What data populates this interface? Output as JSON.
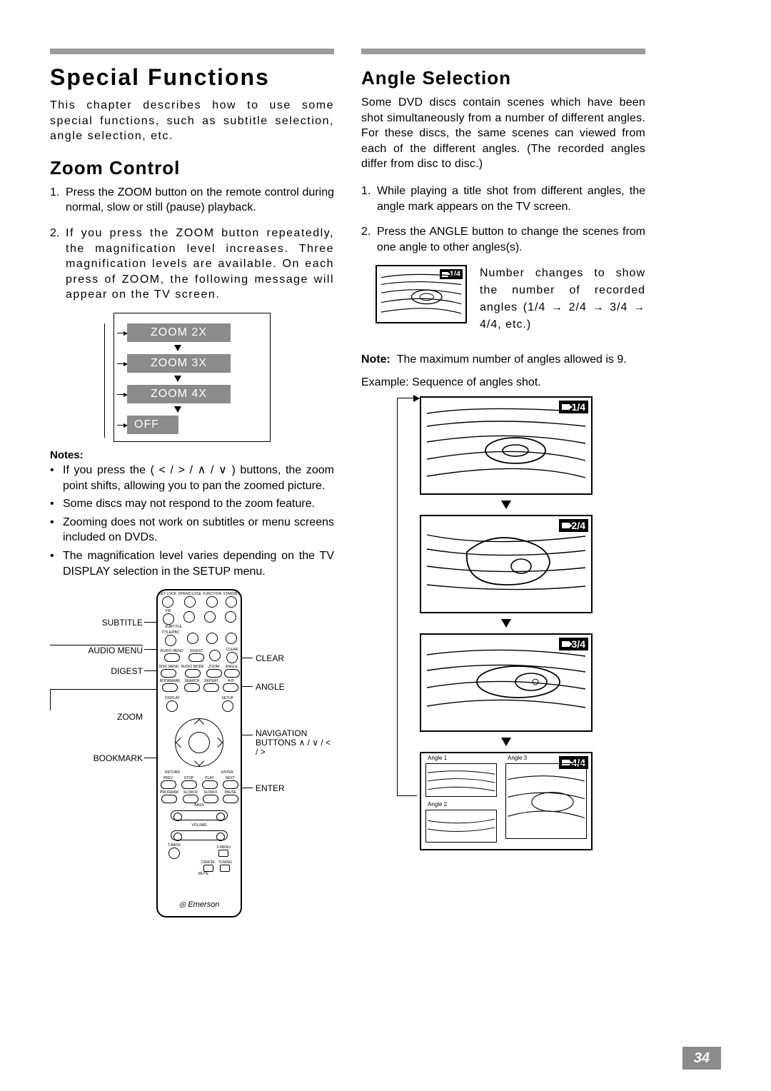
{
  "page_number": "34",
  "left": {
    "chapter_title": "Special Functions",
    "intro": "This chapter describes how to use some special functions, such as subtitle selection, angle selection, etc.",
    "zoom": {
      "heading": "Zoom Control",
      "step1": "Press the ZOOM button on the remote control during normal, slow or still (pause) playback.",
      "step2": "If you press the ZOOM button repeatedly, the magnification level increases. Three magnification levels are available. On each press of ZOOM, the following message will appear on the TV screen.",
      "levels": [
        "ZOOM 2X",
        "ZOOM 3X",
        "ZOOM 4X",
        "OFF"
      ],
      "notes_label": "Notes:",
      "notes": [
        "If you press the ( < / > / ∧ / ∨ ) buttons, the zoom point shifts, allowing you to pan the zoomed picture.",
        "Some discs may not respond to the zoom feature.",
        "Zooming does not work on subtitles or menu screens included on DVDs.",
        "The magnification level varies depending on the TV DISPLAY selection in the SETUP menu."
      ]
    },
    "remote": {
      "brand": "Emerson",
      "row1": [
        "KEY LOCK",
        "OPEN/CLOSE",
        "FUNCTION",
        "STANDBY"
      ],
      "row_fm": "FM",
      "row_sub": "SUBTITLE",
      "row3": [
        "TITLE/PBC",
        "",
        "",
        ""
      ],
      "row4": [
        "AUDIO MENU",
        "DIGEST",
        "",
        "CLEAR"
      ],
      "row5": [
        "DISC MENU",
        "AUDIO MODE",
        "ZOOM",
        "ANGLE"
      ],
      "row6": [
        "BOOKMARK",
        "SEARCH",
        "REPEAT",
        "A-B"
      ],
      "display_setup": [
        "DISPLAY",
        "SETUP"
      ],
      "return_enter": [
        "RETURN",
        "ENTER"
      ],
      "transport": [
        "PREV",
        "STOP",
        "PLAY",
        "NEXT"
      ],
      "transport2": [
        "PROGRAM",
        "SLOW-R",
        "SLOW-F",
        "PAUSE"
      ],
      "sliders": [
        "BASS",
        "VOLUME"
      ],
      "bottom": [
        "T-BASS",
        "X-MENU"
      ],
      "last_row": [
        "CANCEL",
        "TUNING"
      ],
      "mute": "MUTE",
      "callouts": {
        "subtitle": "SUBTITLE",
        "audio_menu": "AUDIO MENU",
        "digest": "DIGEST",
        "zoom": "ZOOM",
        "bookmark": "BOOKMARK",
        "clear": "CLEAR",
        "angle": "ANGLE",
        "nav1": "NAVIGATION",
        "nav2": "BUTTONS ∧ / ∨ / < / >",
        "enter": "ENTER"
      }
    }
  },
  "right": {
    "heading": "Angle Selection",
    "intro": "Some DVD discs contain scenes which have been shot simultaneously from a number of different angles. For these discs, the same scenes can viewed from each of the different angles. (The recorded angles differ from disc to disc.)",
    "step1": "While playing a title shot from different angles, the angle mark appears on the TV screen.",
    "step2": "Press the ANGLE button to change the scenes from one angle to other angles(s).",
    "badge_small": "1/4",
    "number_text": "Number changes to show the number of recorded angles (1/4 → 2/4 → 3/4 → 4/4, etc.)",
    "note_label": "Note:",
    "note_text": "The maximum number of angles allowed is 9.",
    "example": "Example: Sequence of angles shot.",
    "sequence_badges": [
      "1/4",
      "2/4",
      "3/4",
      "4/4"
    ],
    "split_labels": [
      "Angle 1",
      "Angle 3",
      "Angle 2"
    ]
  }
}
